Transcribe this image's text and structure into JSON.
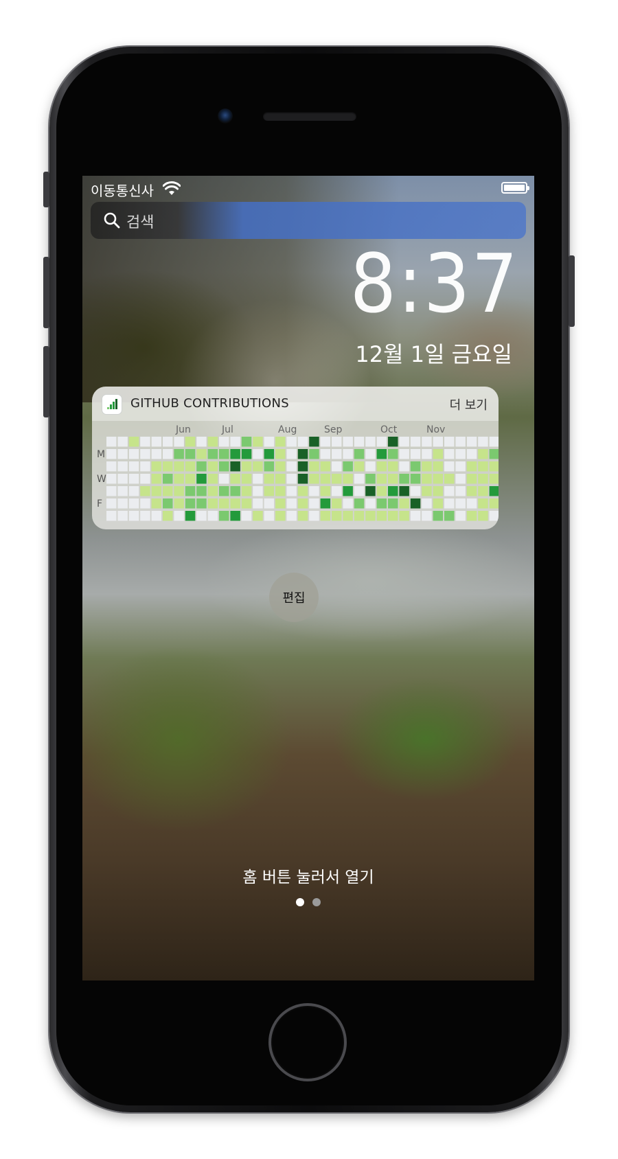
{
  "status_bar": {
    "carrier": "이동통신사"
  },
  "search": {
    "placeholder": "검색"
  },
  "lock_screen": {
    "time": "8:37",
    "date": "12월 1일 금요일"
  },
  "widget": {
    "title": "GITHUB CONTRIBUTIONS",
    "more_label": "더 보기",
    "months": [
      "Jun",
      "Jul",
      "Aug",
      "Sep",
      "Oct",
      "Nov"
    ],
    "day_labels": {
      "monday": "M",
      "wednesday": "W",
      "friday": "F"
    },
    "grid": [
      "0010000101002101004000000400000000000",
      "0000002212233031042000203200010001213",
      "0000111121241121041102101102110011114",
      "0000121131011011041111021122111011124",
      "0001111221221011010103041340110011323",
      "0000121221111001010310202214010001104",
      "0000010300230101010111111110022011000"
    ],
    "levels": [
      "#ebedf0",
      "#c6e48b",
      "#7bc96f",
      "#239a3b",
      "#196127"
    ]
  },
  "edit_button": {
    "label": "편집"
  },
  "unlock_hint": "홈 버튼 눌러서 열기",
  "page_dots": {
    "count": 2,
    "active": 0
  },
  "colors": {
    "accent_green": "#239a3b",
    "dot_active": "#ffffff",
    "dot_inactive": "#9a9a9a"
  }
}
